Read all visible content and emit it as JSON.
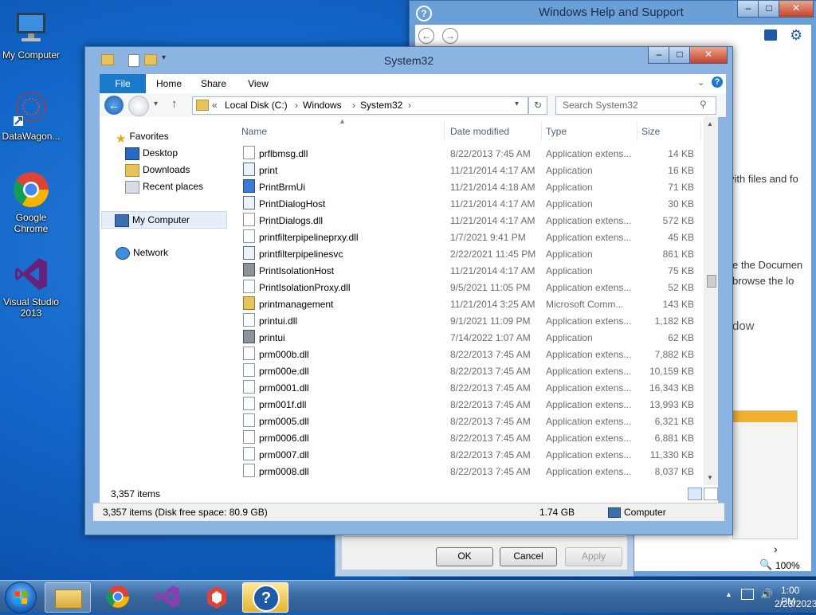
{
  "desktop": {
    "icons": [
      {
        "label": "My Computer",
        "icon": "computer-icon"
      },
      {
        "label": "DataWagon...",
        "icon": "datawagon-icon"
      },
      {
        "label": "Google Chrome",
        "icon": "chrome-icon"
      },
      {
        "label": "Visual Studio 2013",
        "icon": "visual-studio-icon"
      }
    ]
  },
  "help_window": {
    "title": "Windows Help and Support",
    "fragments": [
      "vith files and fo",
      "e the Documen",
      "browse the lo",
      "dow"
    ],
    "zoom": "100%"
  },
  "background_dialog": {
    "ok": "OK",
    "cancel": "Cancel",
    "apply": "Apply"
  },
  "explorer": {
    "title": "System32",
    "ribbon_tabs": [
      "File",
      "Home",
      "Share",
      "View"
    ],
    "address": {
      "prefix": "«",
      "crumbs": [
        "Local Disk (C:)",
        "Windows",
        "System32"
      ],
      "search_placeholder": "Search System32"
    },
    "nav": {
      "favorites": "Favorites",
      "desktop": "Desktop",
      "downloads": "Downloads",
      "recent": "Recent places",
      "computer": "My Computer",
      "network": "Network"
    },
    "columns": {
      "name": "Name",
      "date": "Date modified",
      "type": "Type",
      "size": "Size"
    },
    "files": [
      {
        "name": "prflbmsg.dll",
        "date": "8/22/2013 7:45 AM",
        "type": "Application extens...",
        "size": "14 KB",
        "kind": "dll"
      },
      {
        "name": "print",
        "date": "11/21/2014 4:17 AM",
        "type": "Application",
        "size": "16 KB",
        "kind": "exe"
      },
      {
        "name": "PrintBrmUi",
        "date": "11/21/2014 4:18 AM",
        "type": "Application",
        "size": "71 KB",
        "kind": "exe2"
      },
      {
        "name": "PrintDialogHost",
        "date": "11/21/2014 4:17 AM",
        "type": "Application",
        "size": "30 KB",
        "kind": "exe"
      },
      {
        "name": "PrintDialogs.dll",
        "date": "11/21/2014 4:17 AM",
        "type": "Application extens...",
        "size": "572 KB",
        "kind": "dll"
      },
      {
        "name": "printfilterpipelineprxy.dll",
        "date": "1/7/2021 9:41 PM",
        "type": "Application extens...",
        "size": "45 KB",
        "kind": "dll"
      },
      {
        "name": "printfilterpipelinesvc",
        "date": "2/22/2021 11:45 PM",
        "type": "Application",
        "size": "861 KB",
        "kind": "exe"
      },
      {
        "name": "PrintIsolationHost",
        "date": "11/21/2014 4:17 AM",
        "type": "Application",
        "size": "75 KB",
        "kind": "printer"
      },
      {
        "name": "PrintIsolationProxy.dll",
        "date": "9/5/2021 11:05 PM",
        "type": "Application extens...",
        "size": "52 KB",
        "kind": "dll"
      },
      {
        "name": "printmanagement",
        "date": "11/21/2014 3:25 AM",
        "type": "Microsoft Comm...",
        "size": "143 KB",
        "kind": "msc"
      },
      {
        "name": "printui.dll",
        "date": "9/1/2021 11:09 PM",
        "type": "Application extens...",
        "size": "1,182 KB",
        "kind": "dll"
      },
      {
        "name": "printui",
        "date": "7/14/2022 1:07 AM",
        "type": "Application",
        "size": "62 KB",
        "kind": "printer"
      },
      {
        "name": "prm000b.dll",
        "date": "8/22/2013 7:45 AM",
        "type": "Application extens...",
        "size": "7,882 KB",
        "kind": "dll"
      },
      {
        "name": "prm000e.dll",
        "date": "8/22/2013 7:45 AM",
        "type": "Application extens...",
        "size": "10,159 KB",
        "kind": "dll"
      },
      {
        "name": "prm0001.dll",
        "date": "8/22/2013 7:45 AM",
        "type": "Application extens...",
        "size": "16,343 KB",
        "kind": "dll"
      },
      {
        "name": "prm001f.dll",
        "date": "8/22/2013 7:45 AM",
        "type": "Application extens...",
        "size": "13,993 KB",
        "kind": "dll"
      },
      {
        "name": "prm0005.dll",
        "date": "8/22/2013 7:45 AM",
        "type": "Application extens...",
        "size": "6,321 KB",
        "kind": "dll"
      },
      {
        "name": "prm0006.dll",
        "date": "8/22/2013 7:45 AM",
        "type": "Application extens...",
        "size": "6,881 KB",
        "kind": "dll"
      },
      {
        "name": "prm0007.dll",
        "date": "8/22/2013 7:45 AM",
        "type": "Application extens...",
        "size": "11,330 KB",
        "kind": "dll"
      },
      {
        "name": "prm0008.dll",
        "date": "8/22/2013 7:45 AM",
        "type": "Application extens...",
        "size": "8,037 KB",
        "kind": "dll"
      }
    ],
    "item_count": "3,357 items",
    "status": {
      "details": "3,357 items (Disk free space: 80.9 GB)",
      "size": "1.74 GB",
      "location": "Computer"
    }
  },
  "taskbar": {
    "time": "1:00 PM",
    "date": "2/23/2023",
    "pinned": [
      "start-orb",
      "file-explorer",
      "chrome",
      "visual-studio",
      "app",
      "help"
    ]
  }
}
